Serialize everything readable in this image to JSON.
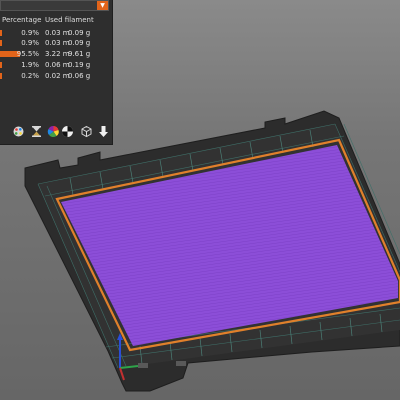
{
  "legend": {
    "headers": {
      "percentage": "Percentage",
      "used_filament": "Used filament"
    },
    "rows": [
      {
        "percentage": "0.9%",
        "length": "0.03 m",
        "weight": "0.09 g",
        "color": "#e2641a"
      },
      {
        "percentage": "0.9%",
        "length": "0.03 m",
        "weight": "0.09 g",
        "color": "#e2641a"
      },
      {
        "percentage": "95.5%",
        "length": "3.22 m",
        "weight": "9.61 g",
        "color": "#e2641a"
      },
      {
        "percentage": "1.9%",
        "length": "0.06 m",
        "weight": "0.19 g",
        "color": "#e2641a"
      },
      {
        "percentage": "0.2%",
        "length": "0.02 m",
        "weight": "0.06 g",
        "color": "#e2641a"
      }
    ],
    "icons": [
      "palette-icon",
      "hourglass-icon",
      "color-wheel-icon",
      "cube-outline-icon",
      "export-arrow-icon"
    ]
  },
  "colors": {
    "print_fill": "#8a4cd6",
    "print_perimeter": "#e0802b",
    "bed": "#2f2f2f",
    "accent": "#e2641a"
  }
}
